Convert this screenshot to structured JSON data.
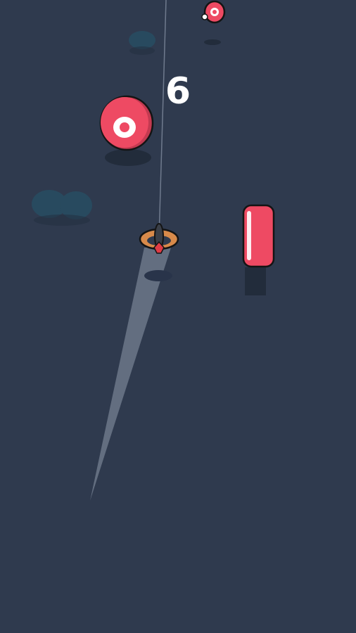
{
  "hud": {
    "score": "6"
  },
  "colors": {
    "background": "#2f3a4e",
    "target_red": "#ee4a63",
    "target_rim": "#c33a51",
    "outline": "#141414",
    "puddle": "#284a5f",
    "beam": "#b9c3d1",
    "plane_orange": "#d88a4a"
  },
  "scene": {
    "targets": [
      {
        "name": "target-small-top",
        "kind": "disc"
      },
      {
        "name": "target-large-left",
        "kind": "disc"
      },
      {
        "name": "target-right-edge",
        "kind": "edge-on"
      }
    ],
    "player": {
      "icon": "plane-icon"
    }
  }
}
